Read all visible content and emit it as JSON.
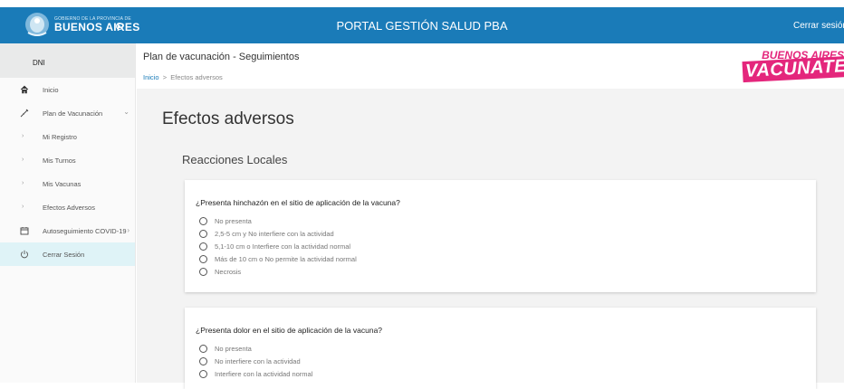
{
  "topbar": {
    "brand_small": "GOBIERNO DE LA PROVINCIA DE",
    "brand": "BUENOS AIRES",
    "title": "PORTAL GESTIÓN SALUD PBA",
    "logout": "Cerrar sesión"
  },
  "sidebar": {
    "user": "DNI",
    "items": [
      {
        "label": "Inicio",
        "icon": "home-icon"
      },
      {
        "label": "Plan de Vacunación",
        "icon": "syringe-icon"
      },
      {
        "label": "Mi Registro",
        "icon": "chevron-right-icon"
      },
      {
        "label": "Mis Turnos",
        "icon": "chevron-right-icon"
      },
      {
        "label": "Mis Vacunas",
        "icon": "chevron-right-icon"
      },
      {
        "label": "Efectos Adversos",
        "icon": "chevron-right-icon"
      },
      {
        "label": "Autoseguimiento COVID-19",
        "icon": "calendar-icon"
      },
      {
        "label": "Cerrar Sesión",
        "icon": "power-icon"
      }
    ]
  },
  "header": {
    "title": "Plan de vacunación - Seguimientos",
    "crumb_home": "Inicio",
    "crumb_sep": ">",
    "crumb_current": "Efectos adversos",
    "logo_top": "BUENOS AIRES",
    "logo_bottom": "VACUNATE"
  },
  "content": {
    "heading": "Efectos adversos",
    "section": "Reacciones Locales",
    "questions": [
      {
        "text": "¿Presenta hinchazón en el sitio de aplicación de la vacuna?",
        "options": [
          "No presenta",
          "2,5-5 cm y No interfiere con la actividad",
          "5,1-10 cm o Interfiere con la actividad normal",
          "Más de 10 cm o No permite la actividad normal",
          "Necrosis"
        ]
      },
      {
        "text": "¿Presenta dolor en el sitio de aplicación de la vacuna?",
        "options": [
          "No presenta",
          "No interfiere con la actividad",
          "Interfiere con la actividad normal"
        ]
      }
    ]
  },
  "colors": {
    "topbar": "#1a7bb8",
    "accent_pink": "#e4267c",
    "active_item_bg": "#dff3f7"
  }
}
